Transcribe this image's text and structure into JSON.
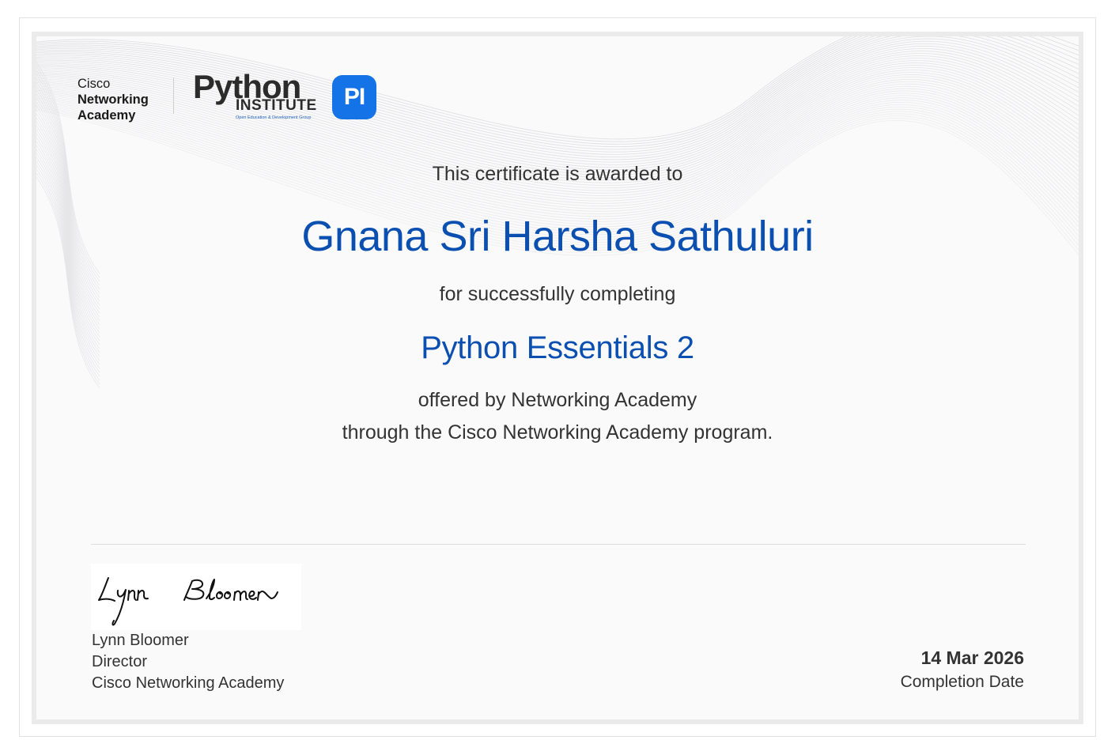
{
  "logos": {
    "cisco": {
      "line1": "Cisco",
      "line2": "Networking",
      "line3": "Academy"
    },
    "python_institute": {
      "word": "Python",
      "institute": "INSTITUTE",
      "tagline": "Open Education & Development Group",
      "badge": "PI",
      "badge_color": "#1473e6"
    }
  },
  "certificate": {
    "awarded_text": "This certificate is awarded to",
    "recipient": "Gnana Sri Harsha Sathuluri",
    "completing_text": "for successfully completing",
    "course": "Python Essentials 2",
    "offered_by": "offered by Networking Academy",
    "program_text": "through the Cisco Networking Academy program.",
    "accent_color": "#0b4fb1"
  },
  "signatory": {
    "signature": "Lynn Bloomer",
    "name": "Lynn Bloomer",
    "title": "Director",
    "organization": "Cisco Networking Academy"
  },
  "completion": {
    "date": "14 Mar 2026",
    "label": "Completion Date"
  }
}
